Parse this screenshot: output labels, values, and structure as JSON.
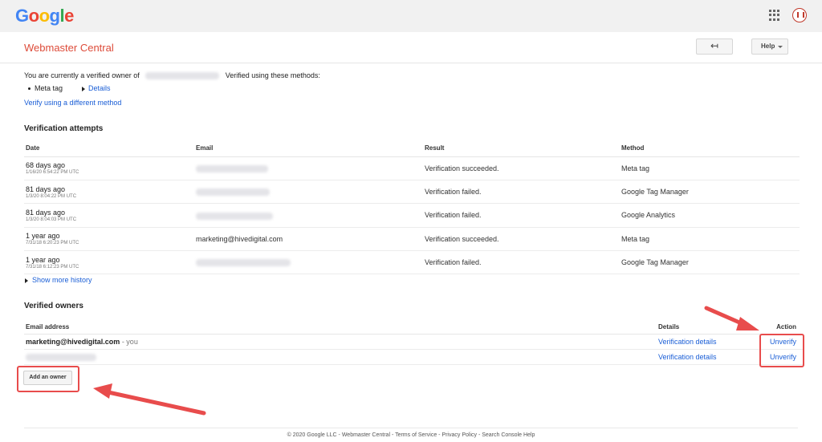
{
  "header": {
    "logo_letters": [
      {
        "ch": "G",
        "color": "#4285F4"
      },
      {
        "ch": "o",
        "color": "#EA4335"
      },
      {
        "ch": "o",
        "color": "#FBBC05"
      },
      {
        "ch": "g",
        "color": "#4285F4"
      },
      {
        "ch": "l",
        "color": "#34A853"
      },
      {
        "ch": "e",
        "color": "#EA4335"
      }
    ],
    "app_title": "Webmaster Central",
    "back_label": "↤",
    "help_label": "Help"
  },
  "ownership": {
    "prefix": "You are currently a verified owner of",
    "suffix": "Verified using these methods:",
    "method": "Meta tag",
    "details_link": "Details",
    "verify_different": "Verify using a different method"
  },
  "attempts": {
    "heading": "Verification attempts",
    "columns": [
      "Date",
      "Email",
      "Result",
      "Method"
    ],
    "rows": [
      {
        "ago": "68 days ago",
        "ts": "1/16/20 6:54:22 PM UTC",
        "email": "",
        "result": "Verification succeeded.",
        "method": "Meta tag"
      },
      {
        "ago": "81 days ago",
        "ts": "1/3/20 8:04:22 PM UTC",
        "email": "",
        "result": "Verification failed.",
        "method": "Google Tag Manager"
      },
      {
        "ago": "81 days ago",
        "ts": "1/3/20 8:04:03 PM UTC",
        "email": "",
        "result": "Verification failed.",
        "method": "Google Analytics"
      },
      {
        "ago": "1 year ago",
        "ts": "7/31/18 6:20:23 PM UTC",
        "email": "marketing@hivedigital.com",
        "result": "Verification succeeded.",
        "method": "Meta tag"
      },
      {
        "ago": "1 year ago",
        "ts": "7/31/18 6:12:23 PM UTC",
        "email": "",
        "result": "Verification failed.",
        "method": "Google Tag Manager"
      }
    ],
    "show_more": "Show more history"
  },
  "owners": {
    "heading": "Verified owners",
    "col_email": "Email address",
    "col_details": "Details",
    "col_action": "Action",
    "rows": [
      {
        "email": "marketing@hivedigital.com",
        "you": " - you",
        "details": "Verification details",
        "action": "Unverify"
      },
      {
        "email": "",
        "you": "",
        "details": "Verification details",
        "action": "Unverify"
      }
    ],
    "add_owner": "Add an owner"
  },
  "footer": "© 2020 Google LLC - Webmaster Central - Terms of Service - Privacy Policy - Search Console Help",
  "colors": {
    "title_red": "#dd4b39",
    "link_blue": "#1a5ed6",
    "annotation_red": "#e84c4c"
  }
}
